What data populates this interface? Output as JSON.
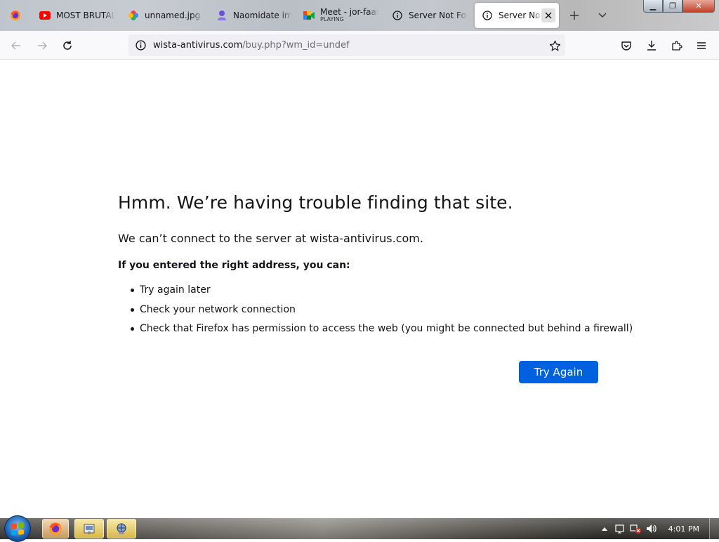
{
  "tabs": [
    {
      "title": "",
      "icon": "firefox-icon"
    },
    {
      "title": "MOST BRUTAL",
      "icon": "youtube-icon"
    },
    {
      "title": "unnamed.jpg (",
      "icon": "google-photos-icon"
    },
    {
      "title": "Naomidate im",
      "icon": "profile-icon"
    },
    {
      "title": "Meet - jor-faas",
      "subtitle": "PLAYING",
      "icon": "google-meet-icon"
    },
    {
      "title": "Server Not Foun",
      "icon": "info-icon"
    },
    {
      "title": "Server Not F",
      "icon": "info-icon",
      "active": true
    }
  ],
  "window_controls": {
    "minimize": "▁",
    "maximize": "❐",
    "close": "✕"
  },
  "urlbar": {
    "host": "wista-antivirus.com",
    "path": "/buy.php?wm_id=undef"
  },
  "error_page": {
    "title": "Hmm. We’re having trouble finding that site.",
    "description": "We can’t connect to the server at wista-antivirus.com.",
    "lead": "If you entered the right address, you can:",
    "suggestions": [
      "Try again later",
      "Check your network connection",
      "Check that Firefox has permission to access the web (you might be connected but behind a firewall)"
    ],
    "button_label": "Try Again"
  },
  "taskbar": {
    "clock": "4:01 PM"
  },
  "colors": {
    "accent": "#0061e0",
    "text": "#15141a",
    "url_path": "#6b6b75"
  }
}
